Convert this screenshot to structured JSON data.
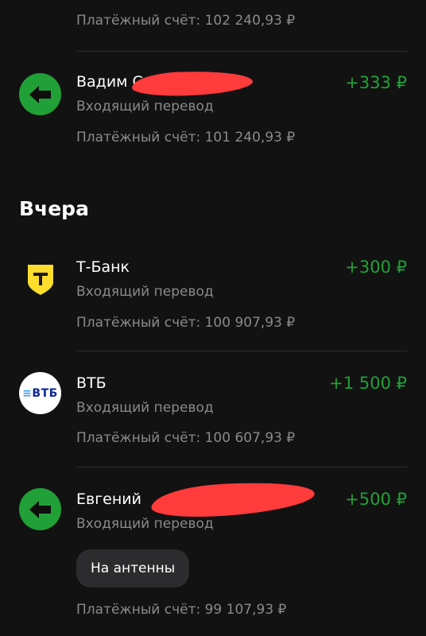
{
  "top_item": {
    "balance": "Платёжный счёт: 102 240,93 ₽"
  },
  "transactions": [
    {
      "name": "Вадим С",
      "type": "Входящий перевод",
      "amount": "+333 ₽",
      "balance": "Платёжный счёт: 101 240,93 ₽",
      "icon": "arrow-left-icon"
    }
  ],
  "section": {
    "title": "Вчера"
  },
  "yesterday": [
    {
      "name": "Т-Банк",
      "type": "Входящий перевод",
      "amount": "+300 ₽",
      "balance": "Платёжный счёт: 100 907,93 ₽",
      "icon": "tbank-logo-icon"
    },
    {
      "name": "ВТБ",
      "type": "Входящий перевод",
      "amount": "+1 500 ₽",
      "balance": "Платёжный счёт: 100 607,93 ₽",
      "icon": "vtb-logo-icon",
      "logo_text": "ВТБ"
    },
    {
      "name": "Евгений",
      "type": "Входящий перевод",
      "amount": "+500 ₽",
      "comment": "На антенны",
      "balance": "Платёжный счёт: 99 107,93 ₽",
      "icon": "arrow-left-icon"
    }
  ],
  "colors": {
    "background": "#121212",
    "income": "#21a038",
    "secondary_text": "#8a8a8e",
    "redaction": "#ff3b3b"
  }
}
